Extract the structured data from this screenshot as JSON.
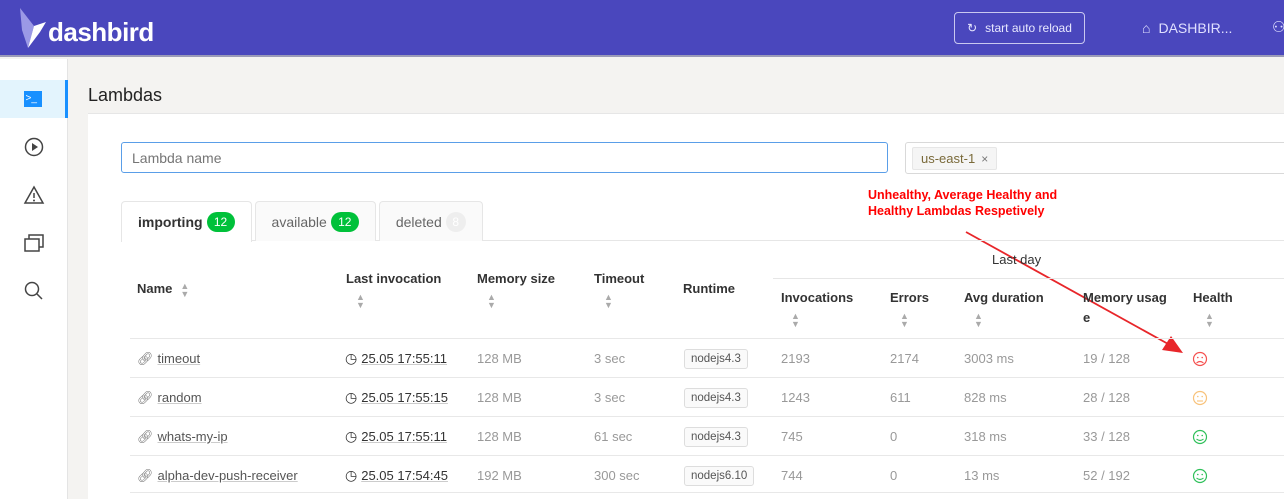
{
  "header": {
    "brand": "dashbird",
    "reload_label": "start auto reload",
    "dashboard_label": "DASHBIR...",
    "colors": {
      "bar": "#4a47bd"
    }
  },
  "sidebar": {
    "items": [
      {
        "icon": "terminal-icon",
        "active": true
      },
      {
        "icon": "play-icon"
      },
      {
        "icon": "warning-icon"
      },
      {
        "icon": "stack-icon"
      },
      {
        "icon": "search-icon"
      }
    ]
  },
  "page": {
    "title": "Lambdas"
  },
  "search": {
    "placeholder": "Lambda name",
    "value": ""
  },
  "region": {
    "selected": "us-east-1",
    "remove": "×"
  },
  "annotation": {
    "text": "Unhealthy, Average Healthy and\nHealthy Lambdas Respetively"
  },
  "tabs": [
    {
      "label": "importing",
      "count": "12"
    },
    {
      "label": "available",
      "count": "12"
    },
    {
      "label": "deleted",
      "count": "8"
    }
  ],
  "table": {
    "group_header": "Last day",
    "columns": {
      "name": "Name",
      "last_invocation": "Last invocation",
      "memory_size": "Memory size",
      "timeout": "Timeout",
      "runtime": "Runtime",
      "invocations": "Invocations",
      "errors": "Errors",
      "avg_duration": "Avg duration",
      "memory_usage_1": "Memory usag",
      "memory_usage_2": "e",
      "health": "Health"
    },
    "rows": [
      {
        "name": "timeout",
        "last": "25.05 17:55:11",
        "mem": "128 MB",
        "timeout": "3 sec",
        "runtime": "nodejs4.3",
        "inv": "2193",
        "err": "2174",
        "dur": "3003 ms",
        "usage": "19 / 128",
        "health": "unhealthy"
      },
      {
        "name": "random",
        "last": "25.05 17:55:15",
        "mem": "128 MB",
        "timeout": "3 sec",
        "runtime": "nodejs4.3",
        "inv": "1243",
        "err": "611",
        "dur": "828 ms",
        "usage": "28 / 128",
        "health": "average"
      },
      {
        "name": "whats-my-ip",
        "last": "25.05 17:55:11",
        "mem": "128 MB",
        "timeout": "61 sec",
        "runtime": "nodejs4.3",
        "inv": "745",
        "err": "0",
        "dur": "318 ms",
        "usage": "33 / 128",
        "health": "healthy"
      },
      {
        "name": "alpha-dev-push-receiver",
        "last": "25.05 17:54:45",
        "mem": "192 MB",
        "timeout": "300 sec",
        "runtime": "nodejs6.10",
        "inv": "744",
        "err": "0",
        "dur": "13 ms",
        "usage": "52 / 192",
        "health": "healthy"
      }
    ]
  },
  "health_colors": {
    "unhealthy": "#f5504f",
    "average": "#f8c27a",
    "healthy": "#2fc05a"
  }
}
